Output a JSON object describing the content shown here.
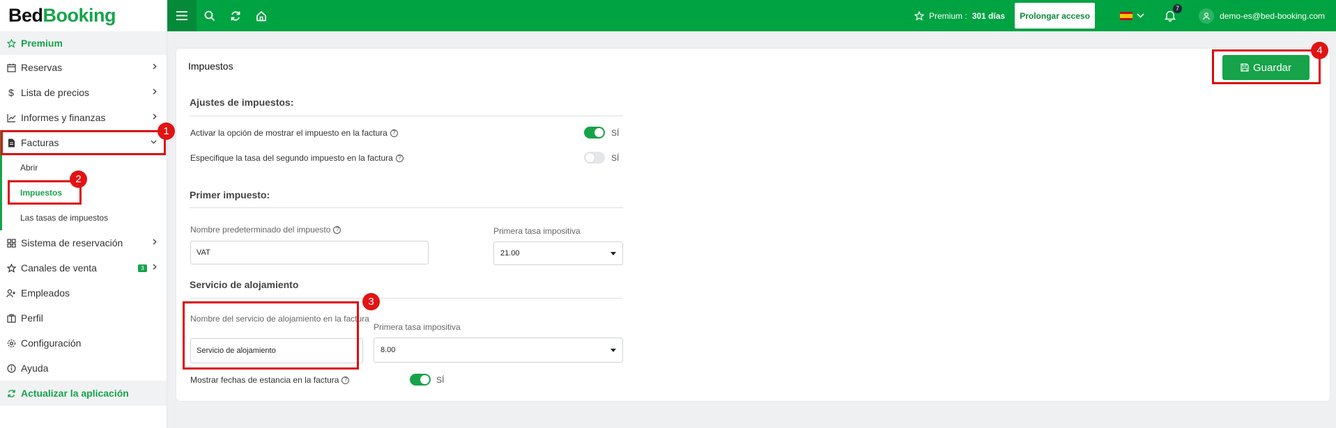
{
  "brand": {
    "part1": "Bed",
    "part2": "Booking"
  },
  "topbar": {
    "premium_label": "Premium :",
    "premium_days": "301 días",
    "prolongar": "Prolongar acceso",
    "notifications_count": "7",
    "user_email": "demo-es@bed-booking.com"
  },
  "sidebar": {
    "premium": "Premium",
    "reservas": "Reservas",
    "lista_precios": "Lista de precios",
    "informes": "Informes y finanzas",
    "facturas": "Facturas",
    "sub_abrir": "Abrir",
    "sub_impuestos": "Impuestos",
    "sub_tasas": "Las tasas de impuestos",
    "sistema": "Sistema de reservación",
    "canales": "Canales de venta",
    "canales_badge": "3",
    "empleados": "Empleados",
    "perfil": "Perfil",
    "configuracion": "Configuración",
    "ayuda": "Ayuda",
    "actualizar": "Actualizar la aplicación"
  },
  "card": {
    "title": "Impuestos",
    "save": "Guardar",
    "ajustes_title": "Ajustes de impuestos:",
    "activar_label": "Activar la opción de mostrar el impuesto en la factura",
    "activar_state": "SÍ",
    "segundo_label": "Especifique la tasa del segundo impuesto en la factura",
    "segundo_state": "SÍ",
    "primer_title": "Primer impuesto:",
    "nombre_label": "Nombre predeterminado del impuesto",
    "nombre_value": "VAT",
    "tasa1_label": "Primera tasa impositiva",
    "tasa1_value": "21.00",
    "servicio_title": "Servicio de alojamiento",
    "servicio_label": "Nombre del servicio de alojamiento en la factura",
    "servicio_value": "Servicio de alojamiento",
    "tasa2_label": "Primera tasa impositiva",
    "tasa2_value": "8.00",
    "fechas_label": "Mostrar fechas de estancia en la factura",
    "fechas_state": "SÍ"
  },
  "annotations": {
    "n1": "1",
    "n2": "2",
    "n3": "3",
    "n4": "4"
  },
  "colors": {
    "brand_green": "#00a341",
    "accent_green": "#16a34a",
    "annotation_red": "#dd0a0a"
  }
}
